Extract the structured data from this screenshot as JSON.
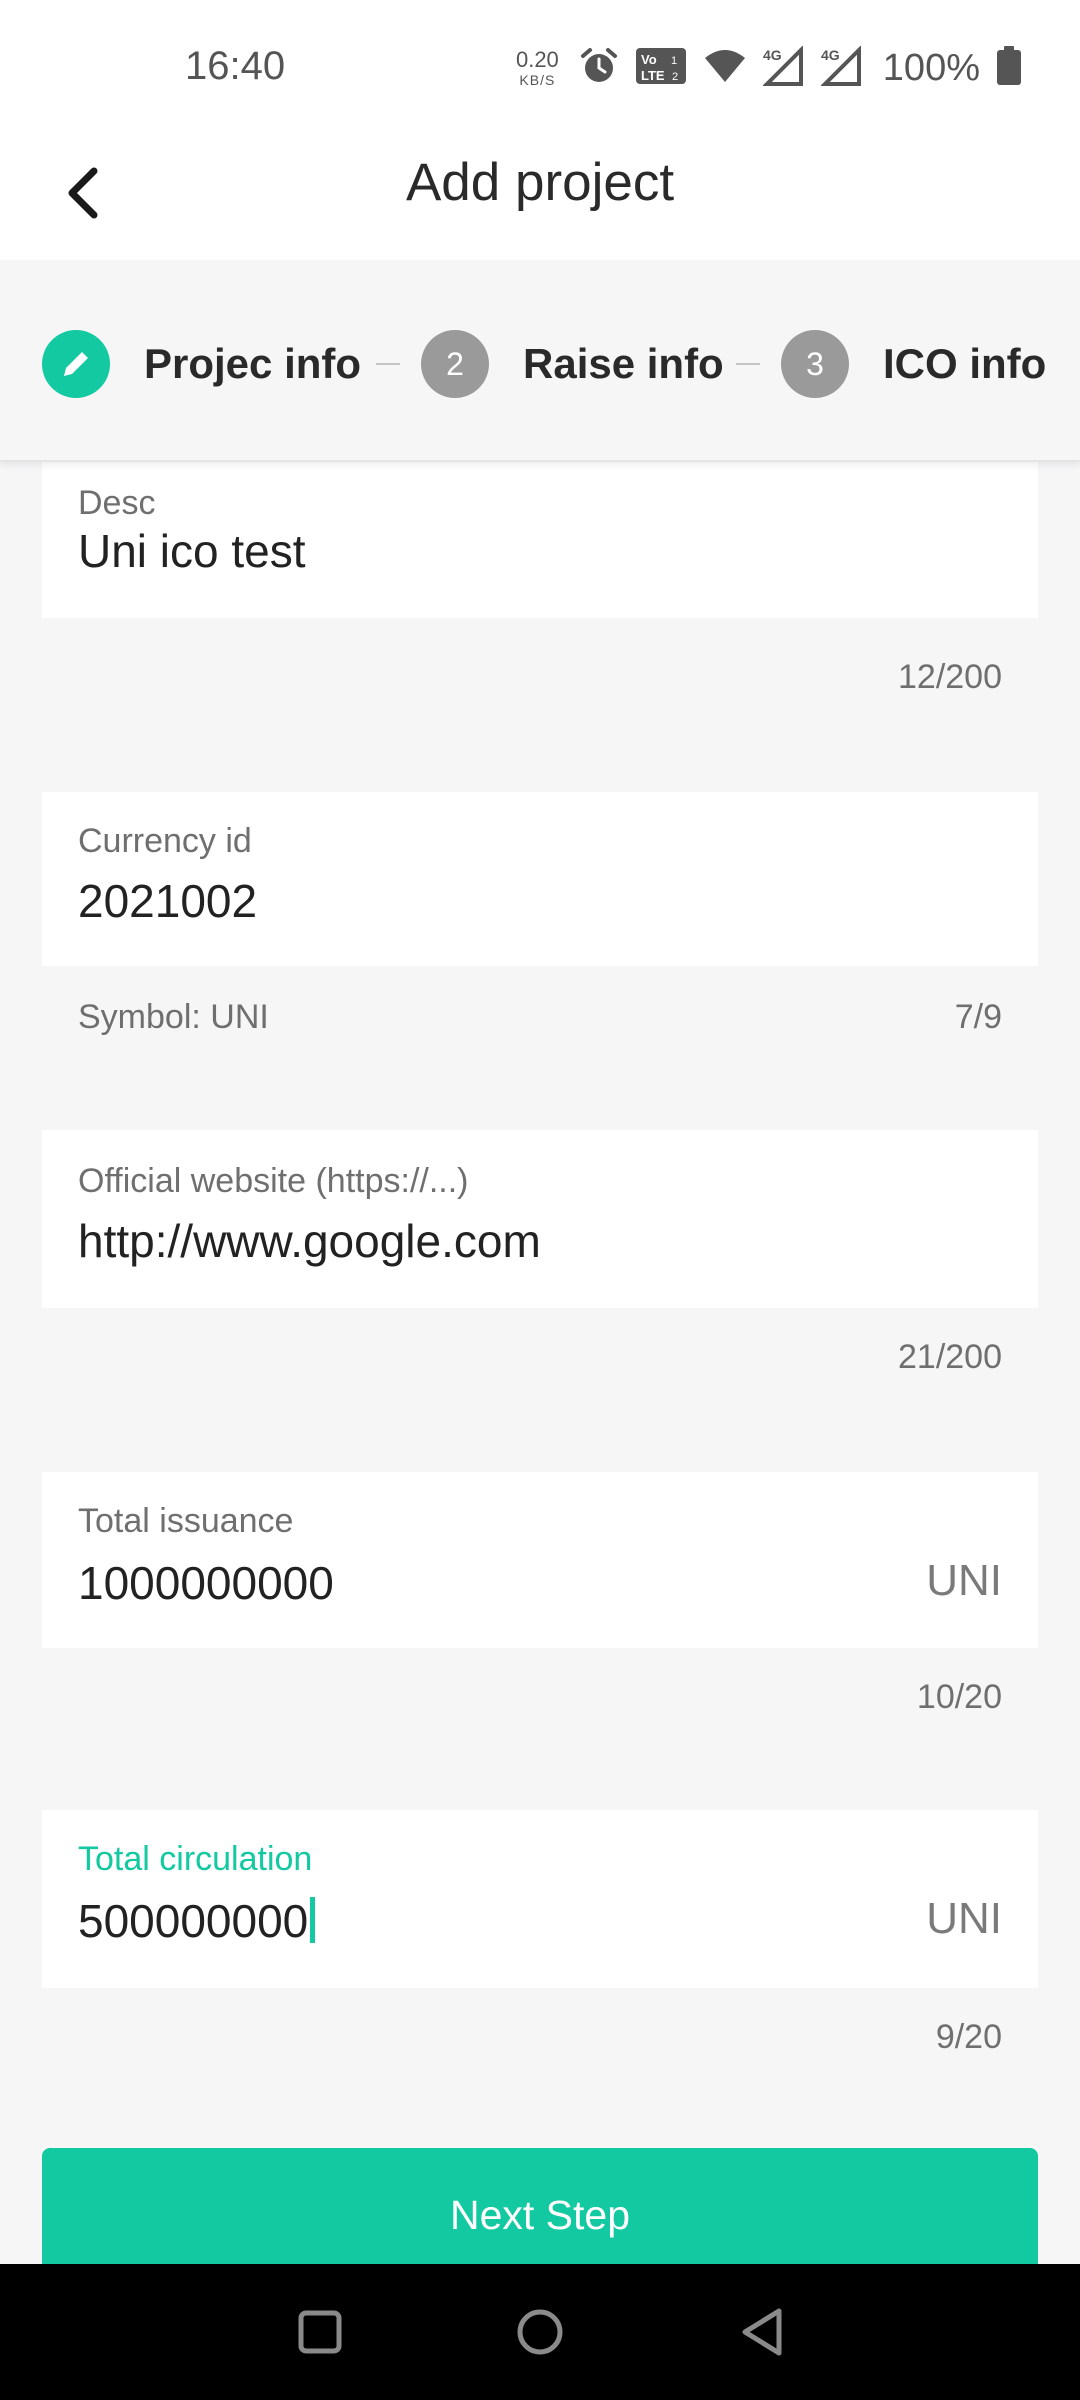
{
  "status_bar": {
    "time": "16:40",
    "net_speed_value": "0.20",
    "net_speed_unit": "KB/S",
    "battery": "100%",
    "icons": [
      "alarm-icon",
      "volte-icon",
      "wifi-icon",
      "signal-4g-icon",
      "signal-4g-icon",
      "battery-icon"
    ]
  },
  "header": {
    "title": "Add project",
    "back_icon": "chevron-left-icon"
  },
  "stepper": {
    "steps": [
      {
        "number": "",
        "label": "Projec info",
        "state": "done",
        "icon": "pencil-icon"
      },
      {
        "number": "2",
        "label": "Raise info",
        "state": "todo"
      },
      {
        "number": "3",
        "label": "ICO info",
        "state": "todo"
      }
    ],
    "colors": {
      "done": "#12c9a1",
      "todo": "#9a9a9a"
    }
  },
  "form": {
    "desc": {
      "label": "Desc",
      "value": "Uni ico test",
      "counter": "12/200"
    },
    "currency_id": {
      "label": "Currency id",
      "value": "2021002",
      "hint": "Symbol: UNI",
      "counter": "7/9"
    },
    "website": {
      "label": "Official website (https://...)",
      "value": "http://www.google.com",
      "counter": "21/200"
    },
    "total_issuance": {
      "label": "Total issuance",
      "value": "1000000000",
      "unit": "UNI",
      "counter": "10/20"
    },
    "total_circulation": {
      "label": "Total circulation",
      "value": "500000000",
      "unit": "UNI",
      "counter": "9/20",
      "focused": true
    }
  },
  "actions": {
    "next_label": "Next Step"
  },
  "colors": {
    "accent": "#12c9a1",
    "background": "#f6f6f7"
  }
}
